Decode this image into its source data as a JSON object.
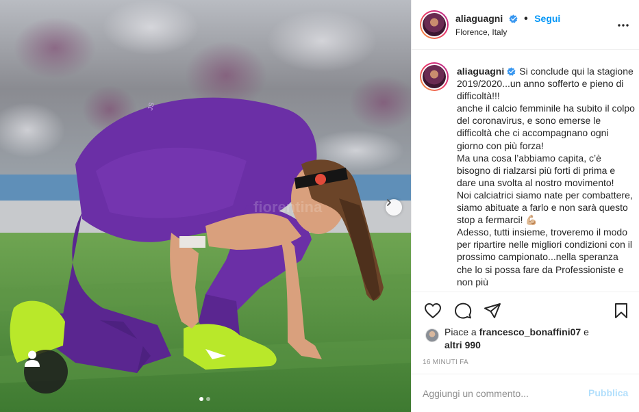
{
  "post": {
    "username": "aliaguagni",
    "verified": true,
    "follow_separator": "•",
    "follow_label": "Segui",
    "location": "Florence, Italy",
    "more_icon": "more-options-icon",
    "caption": "Si conclude qui la stagione 2019/2020...un anno sofferto e pieno di difficoltà!!!\nanche il calcio femminile ha subito il colpo del coronavirus, e sono emerse le difficoltà che ci accompagnano ogni giorno con più forza!\nMa una cosa l’abbiamo capita, c’è bisogno di rialzarsi più forti di prima e dare una svolta al nostro movimento!\nNoi calciatrici siamo nate per combattere, siamo abituate a farlo e non sarà questo stop a fermarci! 💪🏼\nAdesso, tutti insieme, troveremo il modo per ripartire nelle migliori condizioni con il prossimo campionato...nella speranza che lo si possa fare da Professioniste e non più",
    "media": {
      "watermark": "fiorentina",
      "carousel_count": 2,
      "carousel_active": 1
    }
  },
  "actions": {
    "like_icon": "heart-icon",
    "comment_icon": "comment-icon",
    "share_icon": "share-icon",
    "save_icon": "bookmark-icon"
  },
  "likes": {
    "prefix": "Piace a ",
    "first_user": "francesco_bonaffini07",
    "conjunction": " e",
    "others": "altri 990"
  },
  "timestamp": "16 MINUTI FA",
  "comment": {
    "placeholder": "Aggiungi un commento...",
    "publish_label": "Pubblica"
  },
  "colors": {
    "link_blue": "#0095f6",
    "publish_disabled": "#b2dffc",
    "verified_blue": "#3897f0",
    "jersey_purple": "#6b2fa6",
    "boot_green": "#b9e82a"
  }
}
